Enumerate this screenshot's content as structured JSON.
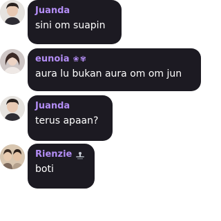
{
  "messages": [
    {
      "sender": "Juanda",
      "text": "sini om suapin",
      "avatar": "avatar-juanda"
    },
    {
      "sender": "eunoia",
      "badge": "❀✾",
      "text": "aura lu bukan aura om om jun",
      "avatar": "avatar-eunoia"
    },
    {
      "sender": "Juanda",
      "text": "terus apaan?",
      "avatar": "avatar-juanda"
    },
    {
      "sender": "Rienzie",
      "badge_icon": "sticker-icon",
      "text": "boti",
      "avatar": "avatar-rienzie"
    }
  ],
  "colors": {
    "bubble_bg": "#1c1a22",
    "name_color": "#b38df5",
    "text_color": "#ffffff"
  }
}
